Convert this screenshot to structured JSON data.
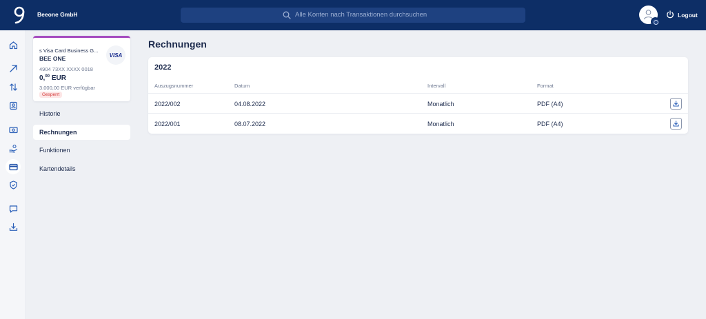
{
  "header": {
    "company": "Beeone GmbH",
    "search_placeholder": "Alle Konten nach Transaktionen durchsuchen",
    "logout_label": "Logout"
  },
  "rail": {
    "icons": [
      "home-icon",
      "arrow-up-right-icon",
      "transfer-icon",
      "contacts-icon",
      "cash-icon",
      "hand-coin-icon",
      "credit-card-icon",
      "shield-icon",
      "chat-icon",
      "download-icon"
    ],
    "active": "credit-card-icon"
  },
  "card": {
    "name": "s Visa Card Business G...",
    "holder": "BEE ONE",
    "number": "4904 73XX XXXX 0018",
    "balance_main": "0,",
    "balance_cents": "00",
    "balance_currency": "EUR",
    "available": "3.000,00 EUR verfügbar",
    "status": "Gesperrt",
    "brand": "VISA",
    "accent_color": "#a64dbf"
  },
  "subnav": {
    "items": [
      {
        "label": "Historie"
      },
      {
        "label": "Rechnungen"
      },
      {
        "label": "Funktionen"
      },
      {
        "label": "Kartendetails"
      }
    ],
    "active": "Rechnungen"
  },
  "main": {
    "title": "Rechnungen",
    "year": "2022",
    "columns": [
      "Auszugsnummer",
      "Datum",
      "Intervall",
      "Format"
    ],
    "rows": [
      {
        "number": "2022/002",
        "date": "04.08.2022",
        "interval": "Monatlich",
        "format": "PDF (A4)"
      },
      {
        "number": "2022/001",
        "date": "08.07.2022",
        "interval": "Monatlich",
        "format": "PDF (A4)"
      }
    ]
  },
  "colors": {
    "topbar": "#0d2e66",
    "background": "#eef0f4",
    "text": "#1d2b4d",
    "status_red": "#d23636"
  }
}
